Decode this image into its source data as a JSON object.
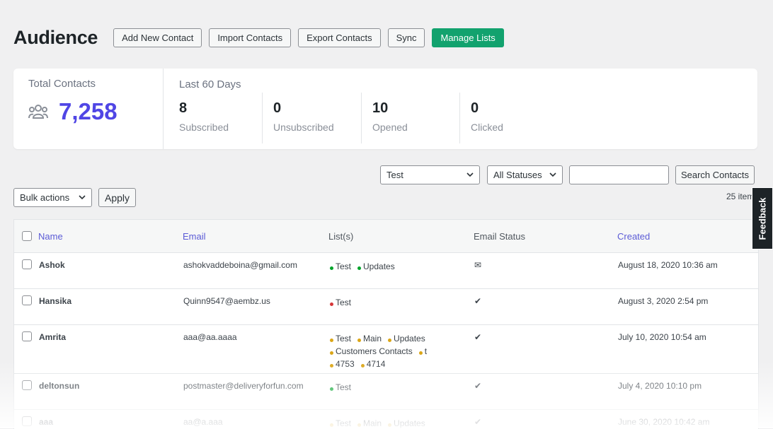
{
  "header": {
    "title": "Audience",
    "buttons": {
      "add_new_contact": "Add New Contact",
      "import_contacts": "Import Contacts",
      "export_contacts": "Export Contacts",
      "sync": "Sync",
      "manage_lists": "Manage Lists"
    }
  },
  "stats": {
    "total_label": "Total Contacts",
    "total_value": "7,258",
    "period_label": "Last 60 Days",
    "items": [
      {
        "value": "8",
        "label": "Subscribed"
      },
      {
        "value": "0",
        "label": "Unsubscribed"
      },
      {
        "value": "10",
        "label": "Opened"
      },
      {
        "value": "0",
        "label": "Clicked"
      }
    ]
  },
  "filters": {
    "list_filter": "Test",
    "status_filter": "All Statuses",
    "search_value": "",
    "search_button": "Search Contacts",
    "bulk_actions": "Bulk actions",
    "apply": "Apply",
    "items_count": "25 item"
  },
  "table": {
    "columns": {
      "name": "Name",
      "email": "Email",
      "lists": "List(s)",
      "status": "Email Status",
      "created": "Created"
    },
    "rows": [
      {
        "name": "Ashok",
        "email": "ashokvaddeboina@gmail.com",
        "lists": [
          {
            "label": "Test",
            "color": "#00a32a"
          },
          {
            "label": "Updates",
            "color": "#00a32a"
          }
        ],
        "status": "✉",
        "created": "August 18, 2020 10:36 am"
      },
      {
        "name": "Hansika",
        "email": "Quinn9547@aembz.us",
        "lists": [
          {
            "label": "Test",
            "color": "#d63638"
          }
        ],
        "status": "✔",
        "created": "August 3, 2020 2:54 pm"
      },
      {
        "name": "Amrita",
        "email": "aaa@aa.aaaa",
        "lists": [
          {
            "label": "Test",
            "color": "#dba617"
          },
          {
            "label": "Main",
            "color": "#dba617"
          },
          {
            "label": "Updates",
            "color": "#dba617"
          },
          {
            "label": "Customers Contacts",
            "color": "#dba617"
          },
          {
            "label": "t",
            "color": "#dba617"
          },
          {
            "label": "4753",
            "color": "#dba617"
          },
          {
            "label": "4714",
            "color": "#dba617"
          }
        ],
        "status": "✔",
        "created": "July 10, 2020 10:54 am"
      },
      {
        "name": "deltonsun",
        "email": "postmaster@deliveryforfun.com",
        "lists": [
          {
            "label": "Test",
            "color": "#00a32a"
          }
        ],
        "status": "✔",
        "created": "July 4, 2020 10:10 pm"
      },
      {
        "name": "aaa",
        "email": "aa@a.aaa",
        "lists": [
          {
            "label": "Test",
            "color": "#dba617"
          },
          {
            "label": "Main",
            "color": "#dba617"
          },
          {
            "label": "Updates",
            "color": "#dba617"
          }
        ],
        "status": "✔",
        "created": "June 30, 2020 10:42 am"
      }
    ]
  },
  "feedback_tab": "Feedback",
  "colors": {
    "accent": "#5046e5",
    "primary_button": "#12a26e",
    "link": "#5b5bd6"
  }
}
